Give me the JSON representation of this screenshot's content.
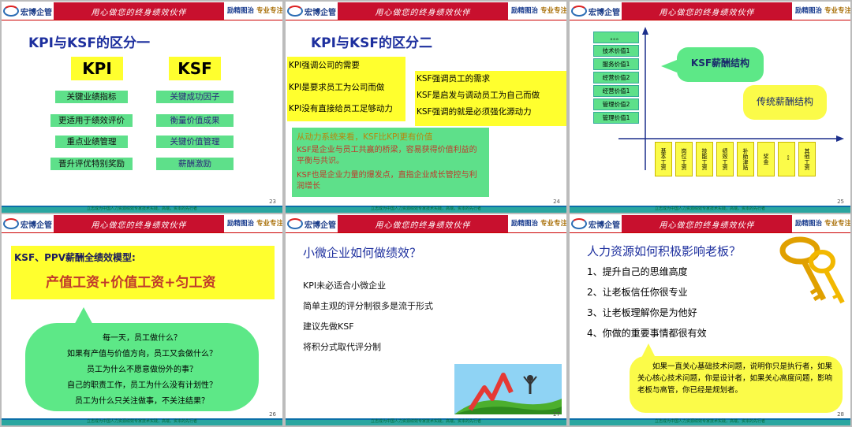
{
  "header": {
    "logo_text": "宏博企管",
    "banner": "用心做您的终身绩效伙伴",
    "tag_a": "励精图治",
    "tag_b": "专业专注"
  },
  "footer_text": "立志成为中国人力资源绩效专家技术实践，高端，资本的先行者",
  "slide1": {
    "title": "KPI与KSF的区分一",
    "kpi_head": "KPI",
    "ksf_head": "KSF",
    "kpi_items": [
      "关键业绩指标",
      "更适用于绩效评价",
      "重点业绩管理",
      "晋升评优特别奖励"
    ],
    "ksf_items": [
      "关键成功因子",
      "衡量价值成果",
      "关键价值管理",
      "薪酬激励"
    ],
    "page": "23"
  },
  "slide2": {
    "title": "KPI与KSF的区分二",
    "kpi_lines": [
      "KPI强调公司的需要",
      "KPI是要求员工为公司而做",
      "KPI没有直接给员工足够动力"
    ],
    "ksf_lines": [
      "KSF强调员工的需求",
      "KSF是启发与调动员工为自己而做",
      "KSF强调的就是必须强化源动力"
    ],
    "green_lines": [
      "从动力系统来看，KSF比KPI更有价值",
      "KSF是企业与员工共赢的桥梁，容易获得价值利益的平衡与共识。",
      "KSF也是企业力量的爆发点，直指企业成长管控与利润增长"
    ],
    "page": "24"
  },
  "slide3": {
    "stack_items": [
      "。。。",
      "技术价值1",
      "服务价值1",
      "经营价值2",
      "经营价值1",
      "管理价值2",
      "管理价值1"
    ],
    "ksf_bubble": "KSF薪酬结构",
    "trad_bubble": "传统薪酬结构",
    "bars": [
      "基本工资",
      "岗位工资",
      "技能工资",
      "绩效工资",
      "补助津贴",
      "奖金",
      "。。",
      "其他工资"
    ],
    "page": "25"
  },
  "slide4": {
    "subtitle": "KSF、PPV薪酬全绩效模型:",
    "formula": "产值工资+价值工资+匀工资",
    "lines": [
      "每一天，员工做什么？",
      "如果有产值与价值方向，员工又会做什么？",
      "员工为什么不愿意做份外的事？",
      "自己的职责工作，员工为什么没有计划性？",
      "员工为什么只关注做事，不关注结果？"
    ],
    "page": "26"
  },
  "slide5": {
    "title": "小微企业如何做绩效？",
    "lines": [
      "KPI未必适合小微企业",
      "简单主观的评分制很多是流于形式",
      "建议先做KSF",
      "将积分式取代评分制"
    ],
    "page": "27"
  },
  "slide6": {
    "title": "人力资源如何积极影响老板？",
    "items": [
      "1、提升自己的思维高度",
      "2、让老板信任你很专业",
      "3、让老板理解你是为他好",
      "4、你做的重要事情都很有效"
    ],
    "quote": "如果一直关心基础技术问题，说明你只是执行者，如果关心核心技术问题，你是设计者，如果关心高度问题，影响老板与高管，你已经是规划者。",
    "page": "28"
  },
  "colors": {
    "red_banner": "#c8102e",
    "green": "#5ee08a",
    "yellow": "#ffff2e",
    "blue_text": "#1d2f9e",
    "footer": "#2aa6a0"
  }
}
